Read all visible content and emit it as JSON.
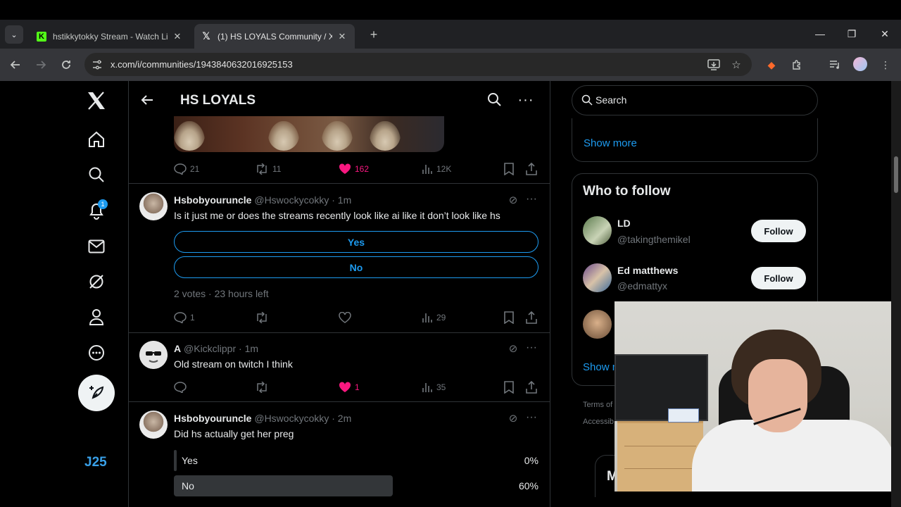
{
  "browser": {
    "tabs": [
      {
        "title": "hstikkytokky Stream - Watch Li",
        "favicon": "kick-icon"
      },
      {
        "title": "(1) HS LOYALS Community / X",
        "favicon": "x-logo-icon"
      }
    ],
    "url": "x.com/i/communities/1943840632016925153"
  },
  "nav": {
    "notification_count": "1",
    "bottom_label": "J25"
  },
  "header": {
    "title": "HS LOYALS"
  },
  "top_post_actions": {
    "replies": "21",
    "reposts": "11",
    "likes": "162",
    "views": "12K"
  },
  "posts": [
    {
      "name": "Hsbobyouruncle",
      "handle": "@Hswockycokky · 1m",
      "text": "Is it just me or does the streams recently look like ai like it don’t look like hs",
      "poll": {
        "options": [
          "Yes",
          "No"
        ],
        "meta": "2 votes · 23 hours left"
      },
      "actions": {
        "replies": "1",
        "reposts": "",
        "likes": "",
        "views": "29"
      }
    },
    {
      "name": "A",
      "handle": "@Kickclippr · 1m",
      "text": "Old stream on twitch I think",
      "actions": {
        "replies": "",
        "reposts": "",
        "likes": "1",
        "views": "35"
      }
    },
    {
      "name": "Hsbobyouruncle",
      "handle": "@Hswockycokky · 2m",
      "text": "Did hs actually get her preg",
      "poll_results": [
        {
          "label": "Yes",
          "percent": "0%",
          "fraction": 0
        },
        {
          "label": "No",
          "percent": "60%",
          "fraction": 0.6
        }
      ]
    }
  ],
  "sidebar": {
    "search_placeholder": "Search",
    "trends_show_more": "Show more",
    "wtf_title": "Who to follow",
    "suggestions": [
      {
        "name": "LD",
        "handle": "@takingthemikel",
        "button": "Follow"
      },
      {
        "name": "Ed matthews",
        "handle": "@edmattyx",
        "button": "Follow"
      }
    ],
    "wtf_show_more": "Show m",
    "footer": [
      "Terms of",
      "Accessib"
    ],
    "messages_peek": "M"
  },
  "colors": {
    "accent": "#1d9bf0",
    "like": "#f91880",
    "background": "#000000",
    "border": "#2f3336"
  }
}
